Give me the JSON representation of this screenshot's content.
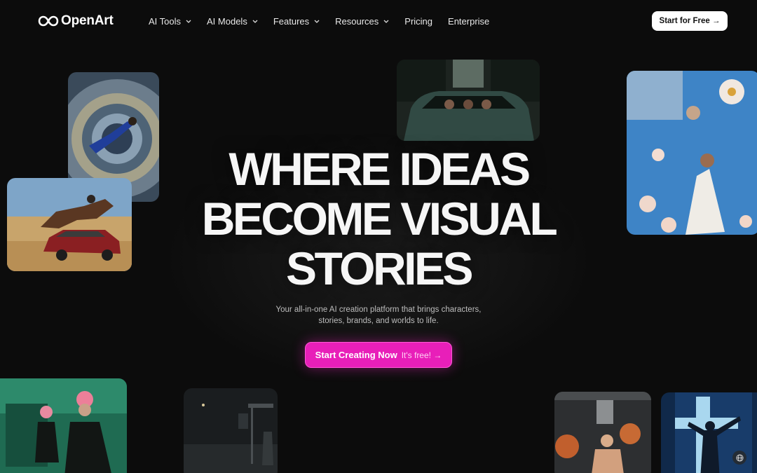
{
  "brand": {
    "name": "OpenArt",
    "logo_icon": "infinity-logo-icon"
  },
  "nav": {
    "items": [
      {
        "label": "AI Tools",
        "has_dropdown": true
      },
      {
        "label": "AI Models",
        "has_dropdown": true
      },
      {
        "label": "Features",
        "has_dropdown": true
      },
      {
        "label": "Resources",
        "has_dropdown": true
      },
      {
        "label": "Pricing",
        "has_dropdown": false
      },
      {
        "label": "Enterprise",
        "has_dropdown": false
      }
    ],
    "cta_label": "Start for Free →"
  },
  "hero": {
    "headline_lines": [
      "WHERE IDEAS",
      "BECOME VISUAL",
      "STORIES"
    ],
    "subtitle_lines": [
      "Your all-in-one AI creation platform that brings characters,",
      "stories, brands, and worlds to life."
    ],
    "cta_primary": "Start Creating Now",
    "cta_secondary": "It's free! →",
    "cta_color": "#e81fb9"
  },
  "gallery": [
    {
      "name": "astronaut-space-station-image"
    },
    {
      "name": "car-in-forest-image"
    },
    {
      "name": "woman-flowers-sky-image"
    },
    {
      "name": "horse-jumping-car-image"
    },
    {
      "name": "pink-hair-mirror-image"
    },
    {
      "name": "bus-stop-night-image"
    },
    {
      "name": "basketball-player-image"
    },
    {
      "name": "cross-light-figure-image"
    }
  ],
  "utility": {
    "globe_icon": "globe-icon"
  }
}
